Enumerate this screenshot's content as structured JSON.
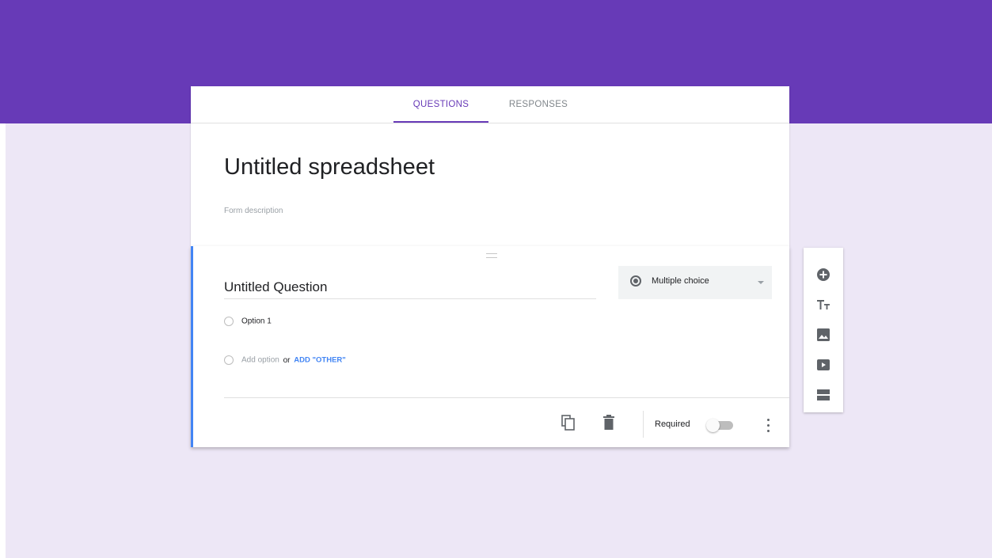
{
  "tabs": {
    "questions": "QUESTIONS",
    "responses": "RESPONSES"
  },
  "form": {
    "title": "Untitled spreadsheet",
    "description_placeholder": "Form description"
  },
  "question": {
    "title": "Untitled Question",
    "type": "Multiple choice",
    "options": [
      "Option 1"
    ],
    "add_option": "Add option",
    "add_or": "or",
    "add_other": "ADD \"OTHER\"",
    "required_label": "Required",
    "required": false
  },
  "toolbar": {
    "icons": [
      "add-circle-icon",
      "title-text-icon",
      "image-icon",
      "video-icon",
      "section-icon"
    ]
  },
  "colors": {
    "header": "#673ab7",
    "background": "#ede7f6",
    "accent": "#4285f4"
  }
}
